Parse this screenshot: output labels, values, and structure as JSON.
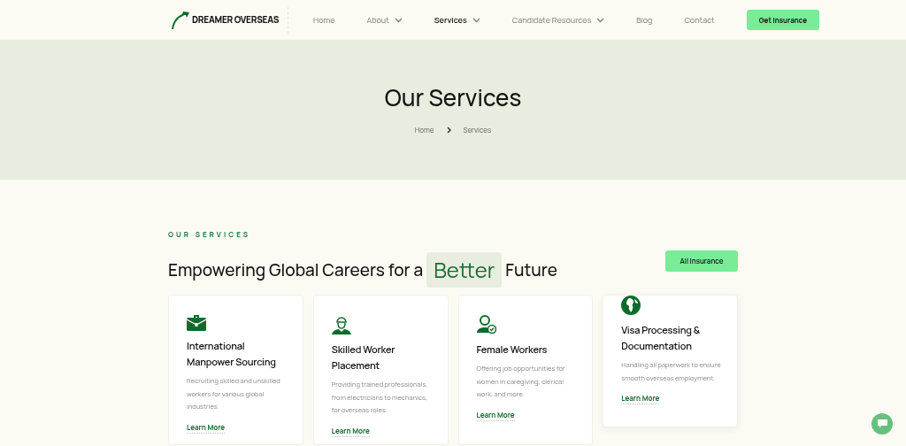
{
  "logo": {
    "name": "DREAMER OVERSEAS"
  },
  "nav": [
    {
      "label": "Home",
      "selected": false,
      "dropdown": false
    },
    {
      "label": "About",
      "selected": false,
      "dropdown": true
    },
    {
      "label": "Services",
      "selected": true,
      "dropdown": true
    },
    {
      "label": "Candidate Resources",
      "selected": false,
      "dropdown": true
    },
    {
      "label": "Blog",
      "selected": false,
      "dropdown": false
    },
    {
      "label": "Contact",
      "selected": false,
      "dropdown": false
    }
  ],
  "nav_button": "Get Insurance",
  "hero": {
    "title": "Our Services",
    "breadcrumb": [
      "Home",
      "Services"
    ]
  },
  "section": {
    "eyebrow": "OUR SERVICES",
    "heading_before": "Empowering Global Careers for a",
    "heading_highlight": "Better",
    "heading_after": "Future",
    "button": "All Insurance"
  },
  "cards": [
    {
      "kind": "briefcase",
      "title": "International Manpower Sourcing",
      "text": "Recruiting skilled and unskilled workers for various global industries.",
      "link": "Learn More",
      "raised": false
    },
    {
      "kind": "worker",
      "title": "Skilled Worker Placement",
      "text": "Providing trained professionals, from electricians to mechanics, for overseas roles.",
      "link": "Learn More",
      "raised": false
    },
    {
      "kind": "female",
      "title": "Female Workers",
      "text": "Offering job opportunities for women in caregiving, clerical work, and more.",
      "link": "Learn More",
      "raised": false
    },
    {
      "kind": "globe",
      "title": "Visa Processing & Documentation",
      "text": "Handling all paperwork to ensure smooth overseas employment.",
      "link": "Learn More",
      "raised": true
    }
  ]
}
